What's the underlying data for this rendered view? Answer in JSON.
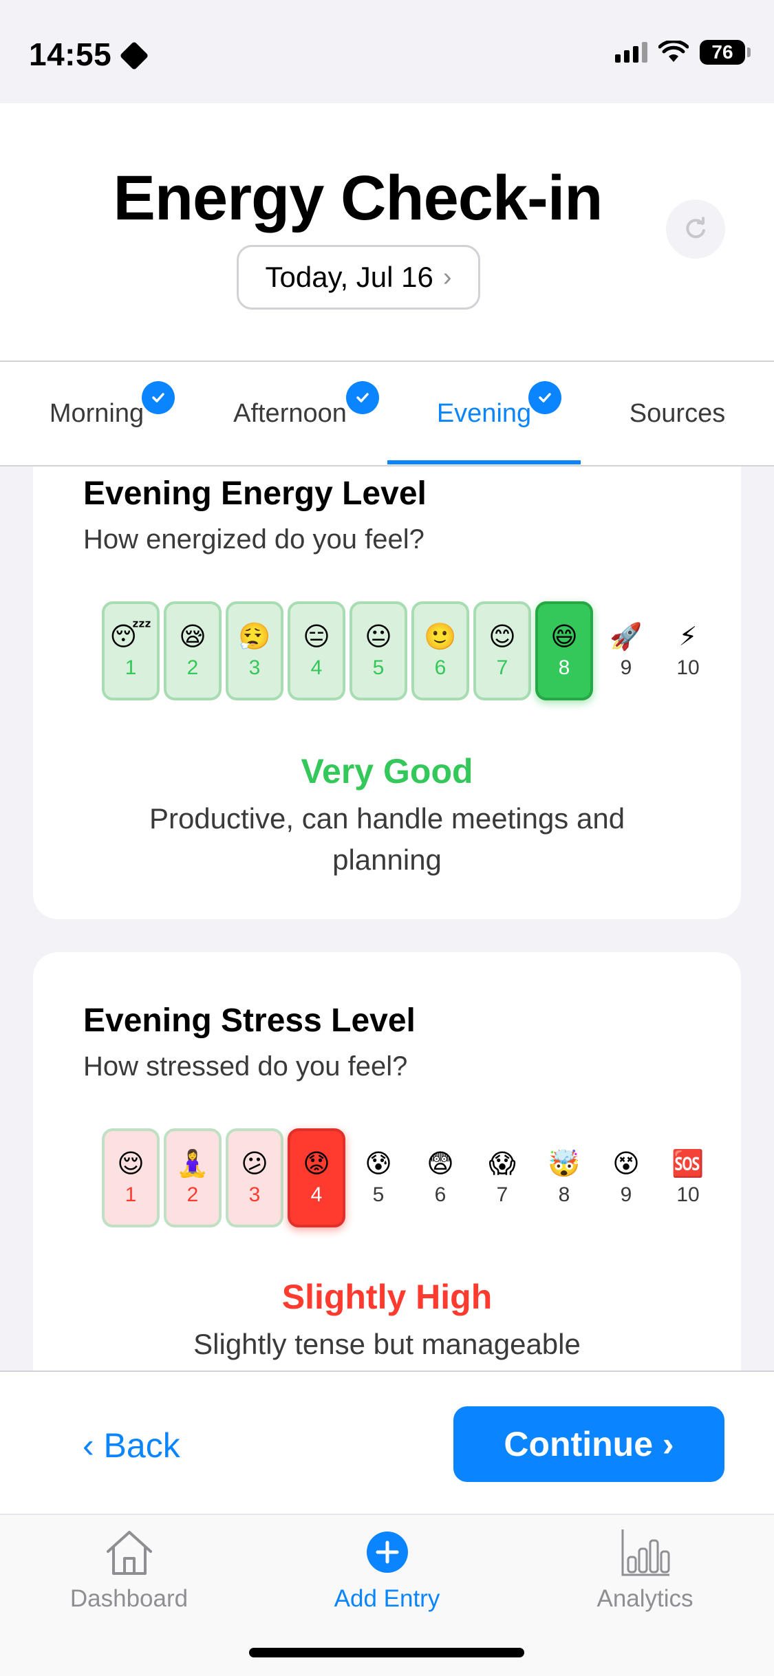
{
  "status_bar": {
    "time": "14:55",
    "battery": "76"
  },
  "header": {
    "title": "Energy Check-in",
    "date_label": "Today, Jul 16",
    "date_chevron": "›"
  },
  "tabs": [
    {
      "label": "Morning",
      "completed": true
    },
    {
      "label": "Afternoon",
      "completed": true
    },
    {
      "label": "Evening",
      "completed": true,
      "active": true
    },
    {
      "label": "Sources",
      "completed": false
    }
  ],
  "energy": {
    "title": "Evening Energy Level",
    "subtitle": "How energized do you feel?",
    "selected": 8,
    "scale": [
      {
        "emoji": "😴",
        "value": "1"
      },
      {
        "emoji": "😪",
        "value": "2"
      },
      {
        "emoji": "😮‍💨",
        "value": "3"
      },
      {
        "emoji": "😑",
        "value": "4"
      },
      {
        "emoji": "😐",
        "value": "5"
      },
      {
        "emoji": "🙂",
        "value": "6"
      },
      {
        "emoji": "😊",
        "value": "7"
      },
      {
        "emoji": "😄",
        "value": "8"
      },
      {
        "emoji": "🚀",
        "value": "9"
      },
      {
        "emoji": "⚡",
        "value": "10"
      }
    ],
    "rating_label": "Very Good",
    "rating_color": "#34c759",
    "description": "Productive, can handle meetings and planning"
  },
  "stress": {
    "title": "Evening Stress Level",
    "subtitle": "How stressed do you feel?",
    "selected": 4,
    "scale": [
      {
        "emoji": "😌",
        "value": "1"
      },
      {
        "emoji": "🧘‍♀️",
        "value": "2"
      },
      {
        "emoji": "😕",
        "value": "3"
      },
      {
        "emoji": "😟",
        "value": "4"
      },
      {
        "emoji": "😰",
        "value": "5"
      },
      {
        "emoji": "😨",
        "value": "6"
      },
      {
        "emoji": "😱",
        "value": "7"
      },
      {
        "emoji": "🤯",
        "value": "8"
      },
      {
        "emoji": "😵",
        "value": "9"
      },
      {
        "emoji": "🆘",
        "value": "10"
      }
    ],
    "rating_label": "Slightly High",
    "rating_color": "#ff3b30",
    "description": "Slightly tense but manageable"
  },
  "actions": {
    "back_label": "‹ Back",
    "continue_label": "Continue ›"
  },
  "tabbar": [
    {
      "label": "Dashboard",
      "icon": "house-icon"
    },
    {
      "label": "Add Entry",
      "icon": "plus-circle-icon",
      "active": true
    },
    {
      "label": "Analytics",
      "icon": "bar-chart-icon"
    }
  ],
  "colors": {
    "accent": "#0a84ff",
    "good": "#34c759",
    "bad": "#ff3b30"
  }
}
